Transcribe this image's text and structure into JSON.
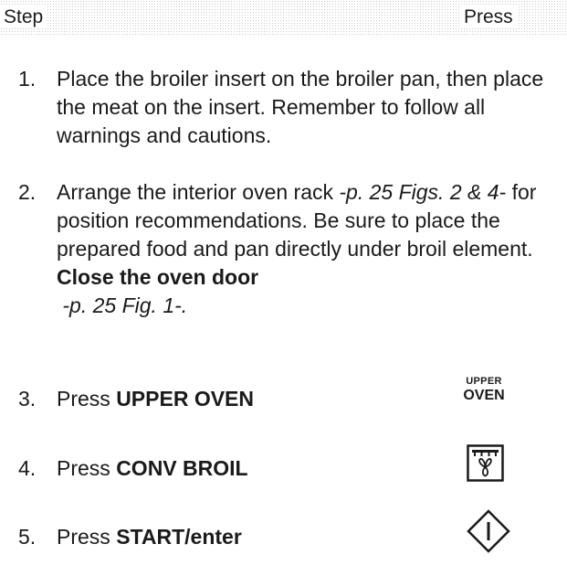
{
  "header": {
    "step_label": "Step",
    "press_label": "Press"
  },
  "steps": [
    {
      "number": "1.",
      "text": "Place the broiler insert on the broiler pan, then place the meat on the insert. Remember to follow all warnings and cautions."
    },
    {
      "number": "2.",
      "text_before": "Arrange the interior oven rack ",
      "ref_1": "-p. 25 Figs. 2 & 4-",
      "text_middle": " for position recommendations. Be sure to place the prepared food and pan directly under broil element. ",
      "bold": "Close the oven door",
      "ref_2": "-p. 25 Fig. 1-."
    },
    {
      "number": "3.",
      "prefix": "Press ",
      "key": "UPPER OVEN"
    },
    {
      "number": "4.",
      "prefix": "Press ",
      "key": "CONV BROIL"
    },
    {
      "number": "5.",
      "prefix": "Press ",
      "key": "START/enter"
    }
  ],
  "icons": {
    "upper_oven": {
      "line1": "UPPER",
      "line2": "OVEN"
    },
    "conv_broil": "conv-broil-icon",
    "start": "start-enter-icon"
  }
}
